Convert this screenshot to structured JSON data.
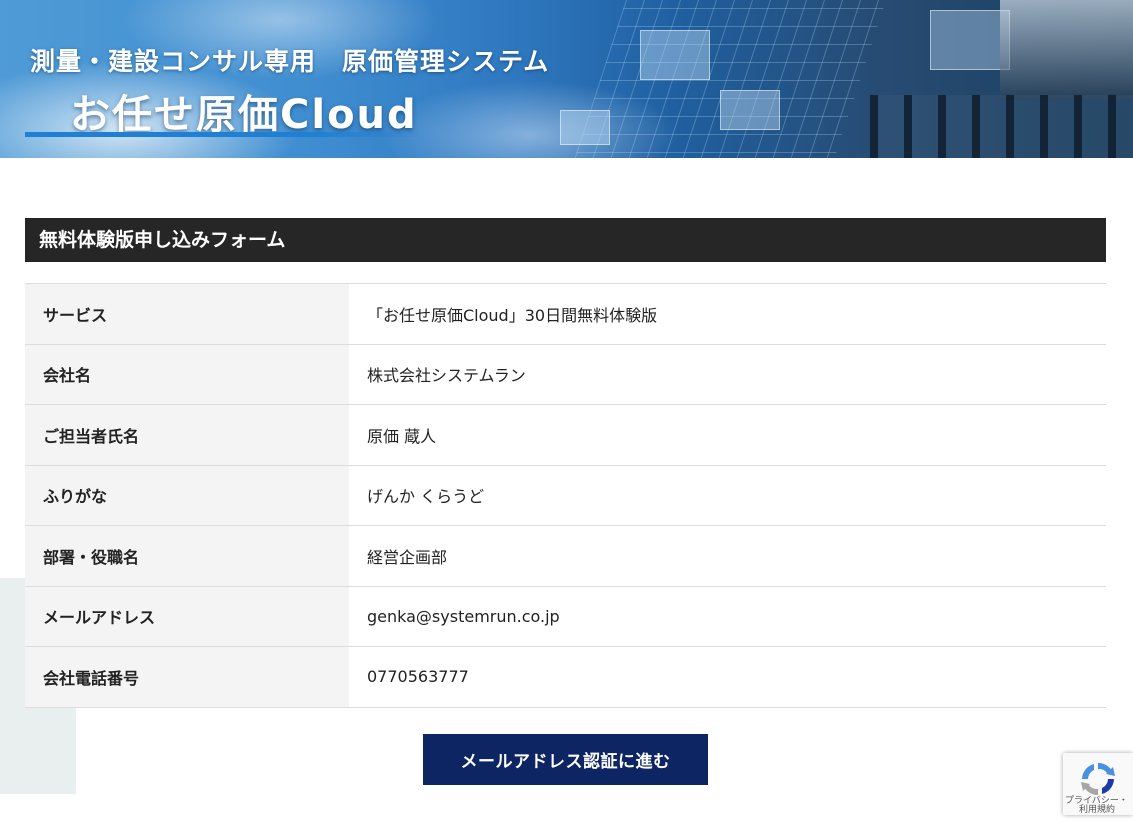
{
  "banner": {
    "subtitle": "測量・建設コンサル専用　原価管理システム",
    "product": "お任せ原価Cloud"
  },
  "form": {
    "title": "無料体験版申し込みフォーム",
    "rows": [
      {
        "label": "サービス",
        "value": "「お任せ原価Cloud」30日間無料体験版"
      },
      {
        "label": "会社名",
        "value": "株式会社システムラン"
      },
      {
        "label": "ご担当者氏名",
        "value": "原価 蔵人"
      },
      {
        "label": "ふりがな",
        "value": "げんか くらうど"
      },
      {
        "label": "部署・役職名",
        "value": "経営企画部"
      },
      {
        "label": "メールアドレス",
        "value": "genka@systemrun.co.jp"
      },
      {
        "label": "会社電話番号",
        "value": "0770563777"
      }
    ],
    "submit_label": "メールアドレス認証に進む"
  },
  "recaptcha": {
    "privacy": "プライバシー・",
    "terms": "利用規約",
    "icon": "recaptcha-logo-icon"
  },
  "colors": {
    "header_bg": "#262626",
    "button_bg": "#0e2563",
    "label_bg": "#f4f4f4"
  }
}
